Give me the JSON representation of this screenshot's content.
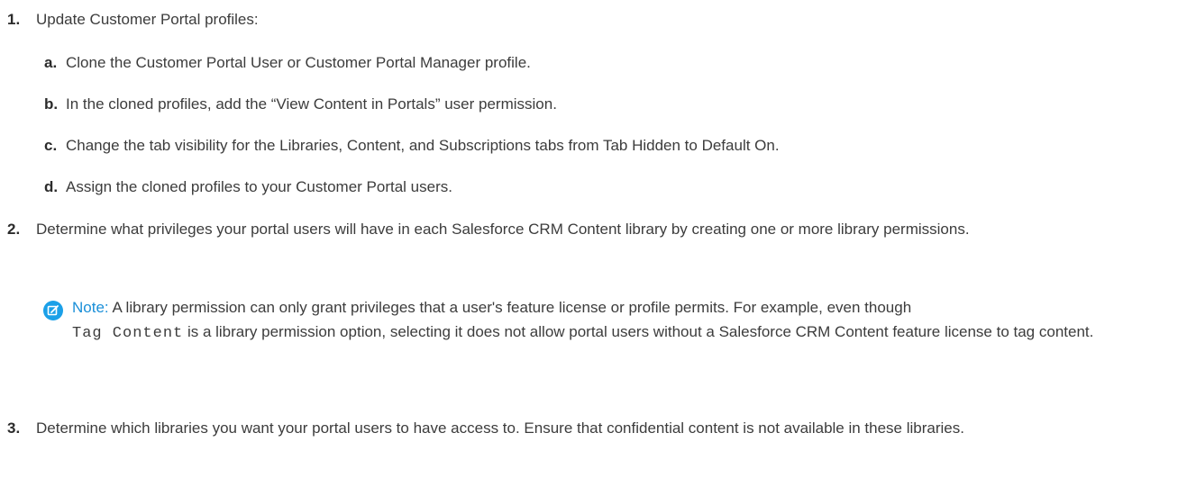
{
  "steps": [
    {
      "number": "1.",
      "text": "Update Customer Portal profiles:",
      "substeps": [
        {
          "letter": "a.",
          "text": "Clone the Customer Portal User or Customer Portal Manager profile."
        },
        {
          "letter": "b.",
          "text": "In the cloned profiles, add the “View Content in Portals” user permission."
        },
        {
          "letter": "c.",
          "text": "Change the tab visibility for the Libraries, Content, and Subscriptions tabs from Tab Hidden to Default On."
        },
        {
          "letter": "d.",
          "text": "Assign the cloned profiles to your Customer Portal users."
        }
      ]
    },
    {
      "number": "2.",
      "text": "Determine what privileges your portal users will have in each Salesforce CRM Content library by creating one or more library permissions.",
      "note": {
        "label": "Note:",
        "text_before": "A library permission can only grant privileges that a user's feature license or profile permits. For example, even though",
        "code": "Tag Content",
        "text_after": "is a library permission option, selecting it does not allow portal users without a Salesforce CRM Content feature license to tag content.",
        "icon": "edit-note-icon",
        "accent": "#1ba0e8"
      }
    },
    {
      "number": "3.",
      "text": "Determine which libraries you want your portal users to have access to. Ensure that confidential content is not available in these libraries."
    }
  ]
}
